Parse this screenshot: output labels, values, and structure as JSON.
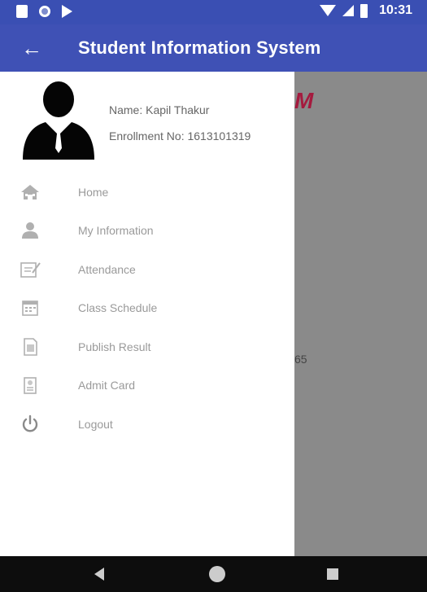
{
  "status_bar": {
    "time": "10:31",
    "icons": [
      "sim-card-icon",
      "record-icon",
      "play-icon",
      "wifi-icon",
      "signal-icon",
      "battery-icon"
    ]
  },
  "app_bar": {
    "back_icon": "arrow-back-icon",
    "back_glyph": "←",
    "title": "Student Information System"
  },
  "drawer": {
    "user": {
      "avatar_icon": "user-silhouette-icon",
      "name": "Name: Kapil Thakur",
      "enrollment": "Enrollment No: 1613101319"
    },
    "menu": [
      {
        "label": "Home",
        "icon": "home-icon"
      },
      {
        "label": "My Information",
        "icon": "person-icon"
      },
      {
        "label": "Attendance",
        "icon": "attendance-icon"
      },
      {
        "label": "Class Schedule",
        "icon": "calendar-icon"
      },
      {
        "label": "Publish Result",
        "icon": "document-icon"
      },
      {
        "label": "Admit Card",
        "icon": "id-card-icon"
      },
      {
        "label": "Logout",
        "icon": "power-icon"
      }
    ]
  },
  "background": {
    "partial_letter": "M",
    "partial_number": "65"
  },
  "nav_bar": {
    "icons": [
      "nav-back-icon",
      "nav-home-icon",
      "nav-recents-icon"
    ]
  },
  "colors": {
    "status_bar": "#3a4fb3",
    "app_bar": "#3f51b5",
    "scrim": "#8a8a8a",
    "menu_text": "#9a9a9a",
    "icon": "#b0b0b0",
    "nav_bar": "#0d0d0d"
  }
}
